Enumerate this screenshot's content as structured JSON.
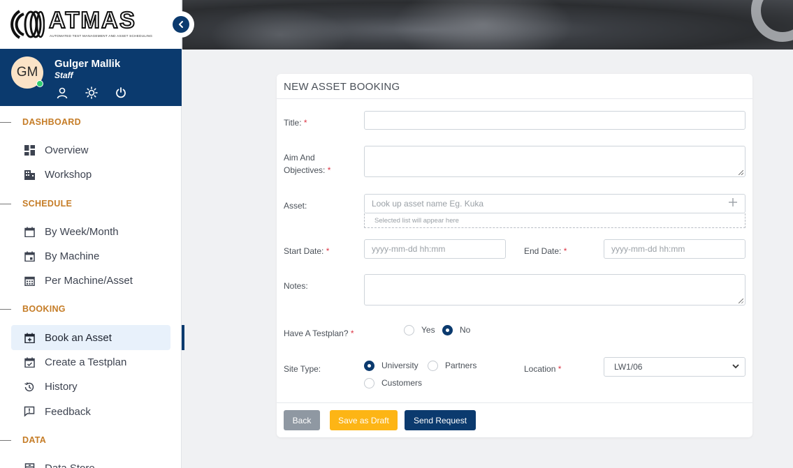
{
  "brand": {
    "name": "ATMAS",
    "tagline": "AUTOMATED TEST MANAGEMENT AND ASSET SCHEDULING"
  },
  "user": {
    "initials": "GM",
    "name": "Gulger Mallik",
    "role": "Staff"
  },
  "nav": {
    "sections": [
      {
        "title": "DASHBOARD",
        "items": [
          {
            "label": "Overview",
            "icon": "dashboard-icon"
          },
          {
            "label": "Workshop",
            "icon": "building-icon"
          }
        ]
      },
      {
        "title": "SCHEDULE",
        "items": [
          {
            "label": "By Week/Month",
            "icon": "calendar-icon"
          },
          {
            "label": "By Machine",
            "icon": "calendar-event-icon"
          },
          {
            "label": "Per Machine/Asset",
            "icon": "calendar-grid-icon"
          }
        ]
      },
      {
        "title": "BOOKING",
        "items": [
          {
            "label": "Book an Asset",
            "icon": "calendar-plus-icon",
            "active": true
          },
          {
            "label": "Create a Testplan",
            "icon": "calendar-check-icon"
          },
          {
            "label": "History",
            "icon": "history-icon"
          },
          {
            "label": "Feedback",
            "icon": "feedback-icon"
          }
        ]
      },
      {
        "title": "DATA",
        "items": [
          {
            "label": "Data Store",
            "icon": "archive-icon"
          }
        ]
      }
    ]
  },
  "form": {
    "heading": "NEW ASSET BOOKING",
    "title_label": "Title:",
    "aim_label_line1": "Aim And",
    "aim_label_line2": "Objectives:",
    "asset_label": "Asset:",
    "asset_placeholder": "Look up asset name Eg. Kuka",
    "asset_selected_hint": "Selected list will appear here",
    "start_label": "Start Date:",
    "start_placeholder": "yyyy-mm-dd hh:mm",
    "end_label": "End Date:",
    "end_placeholder": "yyyy-mm-dd hh:mm",
    "notes_label": "Notes:",
    "testplan_label": "Have A Testplan?",
    "testplan_options": [
      "Yes",
      "No"
    ],
    "testplan_selected": "No",
    "site_label": "Site Type:",
    "site_options": [
      "University",
      "Partners",
      "Customers"
    ],
    "site_selected": "University",
    "location_label": "Location",
    "location_value": "LW1/06",
    "required_mark": "*"
  },
  "buttons": {
    "back": "Back",
    "draft": "Save as Draft",
    "send": "Send Request"
  },
  "colors": {
    "primary": "#0b3a6e",
    "accent": "#c57c26",
    "draft": "#fdb515",
    "back": "#8f98a2",
    "required": "#dc3545"
  }
}
